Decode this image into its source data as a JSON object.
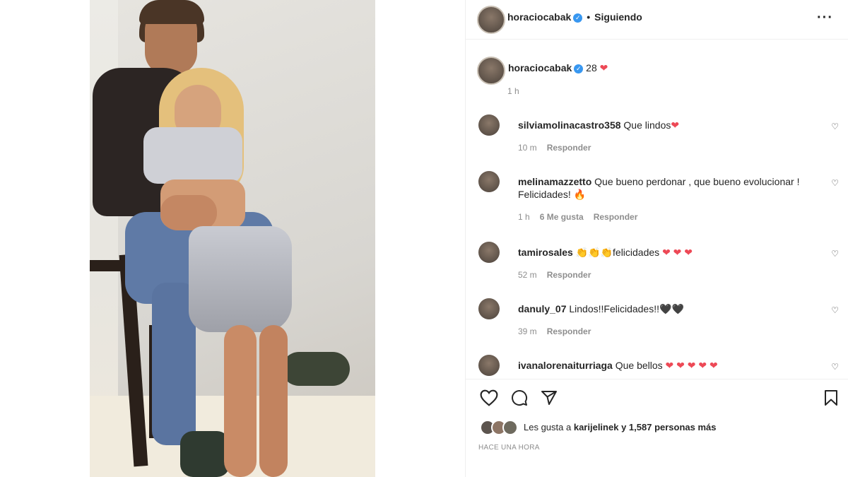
{
  "post": {
    "username": "horaciocabak",
    "follow_status": "Siguiendo",
    "separator": "•",
    "more_icon": "more-horizontal-icon"
  },
  "caption": {
    "username": "horaciocabak",
    "text": "28",
    "emoji": "❤",
    "time": "1 h"
  },
  "comments": [
    {
      "username": "silviamolinacastro358",
      "text": "Que lindos",
      "emoji": "❤",
      "time": "10 m",
      "likes": "",
      "reply": "Responder"
    },
    {
      "username": "melinamazzetto",
      "text": "Que bueno perdonar , que bueno evolucionar ! Felicidades!",
      "emoji": "🔥",
      "time": "1 h",
      "likes": "6 Me gusta",
      "reply": "Responder"
    },
    {
      "username": "tamirosales",
      "text": "👏👏👏felicidades",
      "emoji": "❤ ❤ ❤",
      "time": "52 m",
      "likes": "",
      "reply": "Responder"
    },
    {
      "username": "danuly_07",
      "text": "Lindos!!Felicidades!!",
      "emoji": "🖤🖤",
      "time": "39 m",
      "likes": "",
      "reply": "Responder"
    },
    {
      "username": "ivanalorenaiturriaga",
      "text": "Que bellos",
      "emoji": "❤ ❤ ❤ ❤ ❤",
      "time": "",
      "likes": "",
      "reply": ""
    }
  ],
  "actions": {
    "like_icon": "heart-icon",
    "comment_icon": "comment-icon",
    "share_icon": "send-icon",
    "save_icon": "bookmark-icon"
  },
  "likes": {
    "prefix": "Les gusta a",
    "user": "karijelinek",
    "suffix": "y 1,587 personas más"
  },
  "time_ago": "HACE UNA HORA",
  "colors": {
    "heart": "#ed4956",
    "verified": "#3897f0",
    "muted": "#8e8e8e"
  }
}
